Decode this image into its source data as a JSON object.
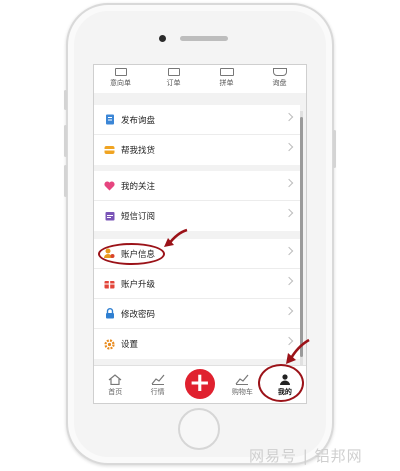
{
  "top_tabs": [
    {
      "label": "意向单",
      "icon": "document-icon"
    },
    {
      "label": "订单",
      "icon": "list-icon"
    },
    {
      "label": "拼单",
      "icon": "truck-icon"
    },
    {
      "label": "询盘",
      "icon": "cart-icon"
    }
  ],
  "menu": {
    "publish_inquiry": "发布询盘",
    "help_find_goods": "帮我找货",
    "my_follows": "我的关注",
    "sms_subscription": "短信订阅",
    "account_info": "账户信息",
    "account_upgrade": "账户升级",
    "change_password": "修改密码",
    "settings": "设置"
  },
  "bottom_nav": {
    "home": "首页",
    "market": "行情",
    "cart": "购物车",
    "mine": "我的"
  },
  "watermark": "网易号 | 铝邦网",
  "colors": {
    "accent_red": "#e0212f",
    "annotation_red": "#9b1218"
  }
}
